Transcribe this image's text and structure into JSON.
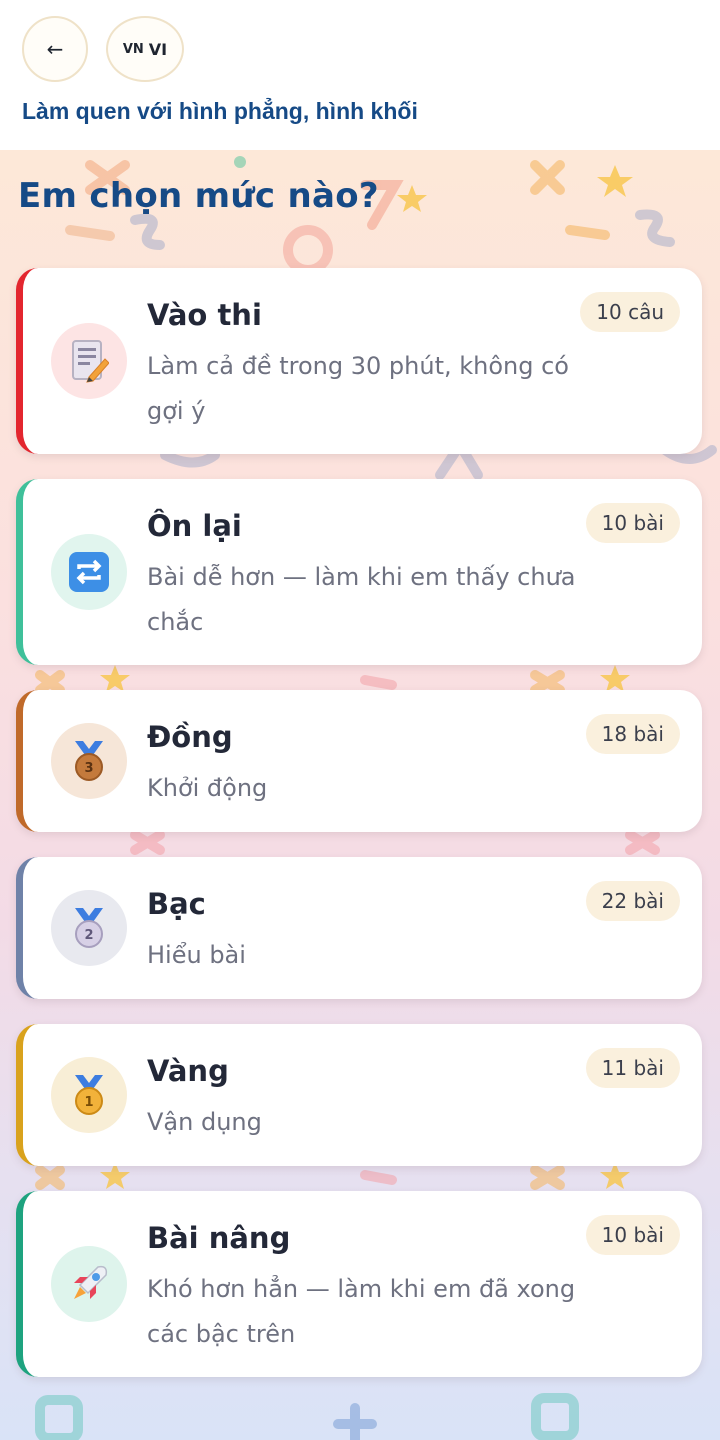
{
  "header": {
    "back_label": "←",
    "lang_flag": "VN",
    "lang_code": "VI",
    "course_title": "Làm quen với hình phẳng, hình khối"
  },
  "heading": "Em chọn mức nào?",
  "cards": [
    {
      "title": "Vào thi",
      "desc": "Làm cả đề trong 30 phút, không có gợi ý",
      "badge": "10 câu",
      "accent": "#e3262f",
      "icon": "exam-icon"
    },
    {
      "title": "Ôn lại",
      "desc": "Bài dễ hơn — làm khi em thấy chưa chắc",
      "badge": "10 bài",
      "accent": "#3fc09a",
      "icon": "repeat-icon"
    },
    {
      "title": "Đồng",
      "desc": "Khởi động",
      "badge": "18 bài",
      "accent": "#c06a2a",
      "icon": "bronze-medal-icon",
      "medal_number": "3"
    },
    {
      "title": "Bạc",
      "desc": "Hiểu bài",
      "badge": "22 bài",
      "accent": "#6f82a8",
      "icon": "silver-medal-icon",
      "medal_number": "2"
    },
    {
      "title": "Vàng",
      "desc": "Vận dụng",
      "badge": "11 bài",
      "accent": "#d9a21d",
      "icon": "gold-medal-icon",
      "medal_number": "1"
    },
    {
      "title": "Bài nâng",
      "desc": "Khó hơn hẳn — làm khi em đã xong các bậc trên",
      "badge": "10 bài",
      "accent": "#1ea37f",
      "icon": "rocket-icon"
    }
  ]
}
